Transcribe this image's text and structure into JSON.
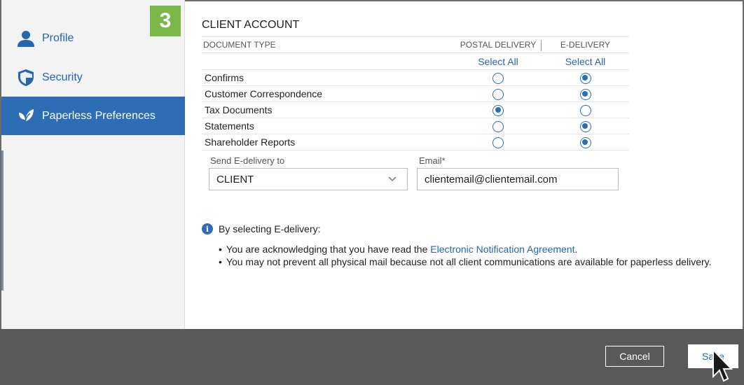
{
  "step_badge": "3",
  "sidebar": {
    "items": [
      {
        "label": "Profile",
        "icon": "person-icon"
      },
      {
        "label": "Security",
        "icon": "shield-icon"
      },
      {
        "label": "Paperless Preferences",
        "icon": "leaf-icon",
        "active": true
      }
    ]
  },
  "section": {
    "title": "CLIENT ACCOUNT",
    "headers": {
      "document_type": "DOCUMENT TYPE",
      "postal": "POSTAL DELIVERY",
      "edelivery": "E-DELIVERY"
    },
    "select_all_postal": "Select All",
    "select_all_edelivery": "Select All",
    "rows": [
      {
        "label": "Confirms",
        "postal": false,
        "edelivery": true
      },
      {
        "label": "Customer Correspondence",
        "postal": false,
        "edelivery": true
      },
      {
        "label": "Tax Documents",
        "postal": true,
        "edelivery": false
      },
      {
        "label": "Statements",
        "postal": false,
        "edelivery": true
      },
      {
        "label": "Shareholder Reports",
        "postal": false,
        "edelivery": true
      }
    ]
  },
  "form": {
    "send_to_label": "Send E-delivery to",
    "send_to_value": "CLIENT",
    "email_label": "Email*",
    "email_value": "clientemail@clientemail.com"
  },
  "info": {
    "heading": "By selecting E-delivery:",
    "bullet1_prefix": "You are acknowledging that you have read the ",
    "bullet1_link": "Electronic Notification Agreement",
    "bullet1_suffix": ".",
    "bullet2": "You may not prevent all physical mail because not all client communications are available for paperless delivery."
  },
  "footer": {
    "cancel_label": "Cancel",
    "save_label": "Save"
  },
  "colors": {
    "accent": "#2d6db5",
    "sidebar_bg": "#f3f3f3",
    "footer_bg": "#595959",
    "badge": "#7ab648"
  }
}
